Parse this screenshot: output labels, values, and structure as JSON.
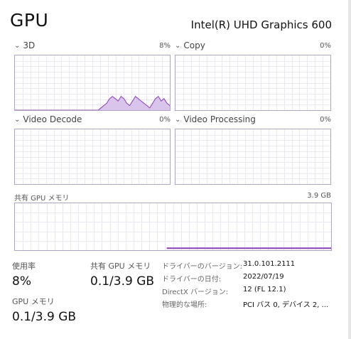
{
  "header": {
    "title": "GPU",
    "device_name": "Intel(R) UHD Graphics 600"
  },
  "graphs": [
    {
      "label": "3D",
      "max": "8%",
      "utilization_series": [
        0,
        0,
        0,
        0,
        0,
        0,
        0,
        0,
        0,
        0,
        0,
        0,
        0,
        0,
        0,
        0,
        0,
        0,
        0,
        0,
        0,
        0,
        0,
        0,
        0,
        0,
        0,
        0,
        0,
        0,
        1,
        2,
        3,
        5,
        6,
        5,
        4,
        6,
        5,
        3,
        2,
        4,
        6,
        5,
        4,
        3,
        2,
        1,
        3,
        5,
        6,
        4,
        5,
        3,
        2
      ]
    },
    {
      "label": "Copy",
      "max": "0%"
    },
    {
      "label": "Video Decode",
      "max": "0%"
    },
    {
      "label": "Video Processing",
      "max": "0%"
    }
  ],
  "shared_memory_graph": {
    "label": "共有 GPU メモリ",
    "max": "3.9 GB",
    "usage_fraction": 0.026
  },
  "stats": {
    "utilization_label": "使用率",
    "utilization_value": "8%",
    "shared_memory_label": "共有 GPU メモリ",
    "shared_memory_value": "0.1/3.9 GB",
    "gpu_memory_label": "GPU メモリ",
    "gpu_memory_value": "0.1/3.9 GB"
  },
  "info": [
    {
      "key": "ドライバーのバージョン:",
      "value": "31.0.101.2111"
    },
    {
      "key": "ドライバーの日付:",
      "value": "2022/07/19"
    },
    {
      "key": "DirectX バージョン:",
      "value": "12 (FL 12.1)"
    },
    {
      "key": "物理的な場所:",
      "value": "PCI バス 0, デバイス 2, ..."
    }
  ],
  "colors": {
    "graph_border": "#b0a4c6",
    "grid": "#ece8f2",
    "line": "#8b3fb8",
    "fill": "#d9c4ec"
  }
}
